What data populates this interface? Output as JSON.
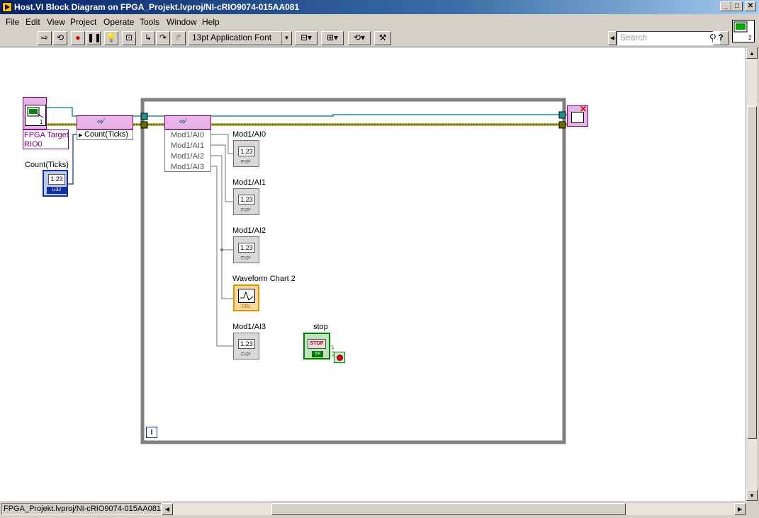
{
  "window": {
    "title": "Host.VI Block Diagram on FPGA_Projekt.lvproj/NI-cRIO9074-015AA081",
    "min": "_",
    "max": "□",
    "close": "✕"
  },
  "menu": [
    "File",
    "Edit",
    "View",
    "Project",
    "Operate",
    "Tools",
    "Window",
    "Help"
  ],
  "toolbar": {
    "font": "13pt Application Font",
    "search_placeholder": "Search",
    "help": "?"
  },
  "diagram": {
    "fpga_target_label_1": "FPGA Target",
    "fpga_target_label_2": "RIO0",
    "count_ticks_property": "Count(Ticks)",
    "count_ticks_control_label": "Count(Ticks)",
    "count_ticks_value": "1.23",
    "count_ticks_type": "U32",
    "read_write_items": [
      "Mod1/AI0",
      "Mod1/AI1",
      "Mod1/AI2",
      "Mod1/AI3"
    ],
    "indicators": [
      {
        "label": "Mod1/AI0",
        "value": "1.23",
        "type": "FXP"
      },
      {
        "label": "Mod1/AI1",
        "value": "1.23",
        "type": "FXP"
      },
      {
        "label": "Mod1/AI2",
        "value": "1.23",
        "type": "FXP"
      },
      {
        "label": "Mod1/AI3",
        "value": "1.23",
        "type": "FXP"
      }
    ],
    "chart_label": "Waveform Chart 2",
    "chart_type": "DBL",
    "stop_label": "stop",
    "stop_button": "STOP",
    "stop_type": "TF",
    "loop_iteration": "i"
  },
  "statusbar": {
    "path": "FPGA_Projekt.lvproj/NI-cRIO9074-015AA081"
  }
}
